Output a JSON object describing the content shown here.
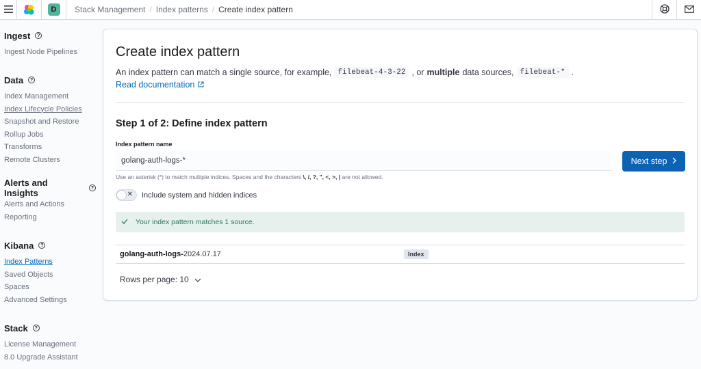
{
  "header": {
    "space_initial": "D",
    "breadcrumbs": [
      "Stack Management",
      "Index patterns",
      "Create index pattern"
    ],
    "icons": [
      "menu-icon",
      "elastic-logo",
      "help-lifebuoy-icon",
      "mail-icon"
    ]
  },
  "sidebar": {
    "groups": [
      {
        "title": "Ingest",
        "items": [
          "Ingest Node Pipelines"
        ]
      },
      {
        "title": "Data",
        "items": [
          "Index Management",
          "Index Lifecycle Policies",
          "Snapshot and Restore",
          "Rollup Jobs",
          "Transforms",
          "Remote Clusters"
        ]
      },
      {
        "title": "Alerts and Insights",
        "items": [
          "Alerts and Actions",
          "Reporting"
        ]
      },
      {
        "title": "Kibana",
        "items": [
          "Index Patterns",
          "Saved Objects",
          "Spaces",
          "Advanced Settings"
        ]
      },
      {
        "title": "Stack",
        "items": [
          "License Management",
          "8.0 Upgrade Assistant"
        ]
      }
    ]
  },
  "main": {
    "title": "Create index pattern",
    "desc_prefix": "An index pattern can match a single source, for example,",
    "desc_code1": "filebeat-4-3-22",
    "desc_mid": ", or",
    "desc_bold": "multiple",
    "desc_suffix": "data sources,",
    "desc_code2": "filebeat-*",
    "desc_end": ".",
    "read_doc": "Read documentation",
    "step_title": "Step 1 of 2: Define index pattern",
    "field_label": "Index pattern name",
    "field_value": "golang-auth-logs-*",
    "next_button": "Next step",
    "help_prefix": "Use an asterisk (*) to match multiple indices. Spaces and the characters",
    "help_chars": "\\, /, ?, \", <, >, |",
    "help_suffix": "are not allowed.",
    "toggle_label": "Include system and hidden indices",
    "callout": "Your index pattern matches 1 source.",
    "result_name_bold": "golang-auth-logs-",
    "result_name_rest": "2024.07.17",
    "result_badge": "Index",
    "rows_per_page": "Rows per page: 10"
  },
  "colors": {
    "primary": "#0d62b3",
    "link": "#006bb8",
    "success_bg": "#e6f1ee",
    "success_text": "#2d7562",
    "space_badge": "#54b399"
  }
}
